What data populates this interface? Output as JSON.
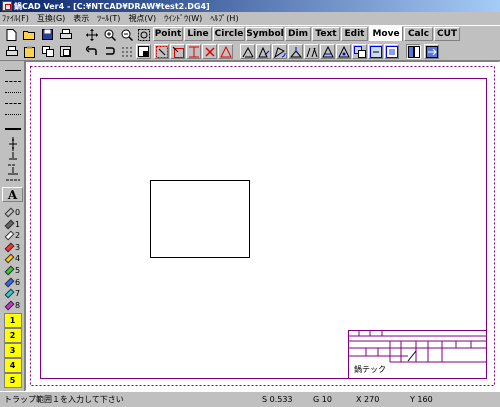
{
  "window": {
    "title": "鍋CAD Ver4 - [C:¥NTCAD¥DRAW¥test2.DG4]"
  },
  "menu": [
    "ﾌｧｲﾙ(F)",
    "互換(G)",
    "表示",
    "ﾂｰﾙ(T)",
    "視点(V)",
    "ｳｲﾝﾄﾞｳ(W)",
    "ﾍﾙﾌﾟ(H)"
  ],
  "tabs": [
    "Point",
    "Line",
    "Circle",
    "Symbol",
    "Dim",
    "Text",
    "Edit",
    "Move",
    "Calc",
    "CUT"
  ],
  "active_tab": "Move",
  "left_toolbar": {
    "text_button": "A",
    "pens": [
      "0",
      "1",
      "2",
      "3",
      "4",
      "5",
      "6",
      "7",
      "8"
    ],
    "pen_colors": [
      "#c0c0c0",
      "#666666",
      "#ffffff",
      "#ff3333",
      "#ffcc00",
      "#33cc33",
      "#3366ff",
      "#33cccc",
      "#cc33cc"
    ],
    "layers": [
      "1",
      "2",
      "3",
      "4",
      "5"
    ]
  },
  "drawing": {
    "title_block_label": "鍋テック"
  },
  "status": {
    "message": "トラップ範囲１を入力して下さい",
    "scale": "S 0.533",
    "grid": "G 10",
    "x": "X 270",
    "y": "Y 160"
  },
  "colors": {
    "titlebar": "#08246b",
    "border": "#800080"
  }
}
